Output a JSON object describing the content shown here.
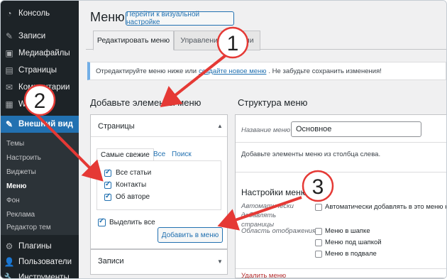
{
  "sidebar": {
    "items": [
      {
        "label": "Консоль",
        "icon": "dashboard-icon",
        "glyph": "◔"
      },
      {
        "label": "Записи",
        "icon": "pin-icon",
        "glyph": "✎"
      },
      {
        "label": "Медиафайлы",
        "icon": "media-icon",
        "glyph": "▣"
      },
      {
        "label": "Страницы",
        "icon": "pages-icon",
        "glyph": "▤"
      },
      {
        "label": "Комментарии",
        "icon": "comments-icon",
        "glyph": "✉"
      },
      {
        "label": "WPForms",
        "icon": "wpforms-icon",
        "glyph": "▦"
      },
      {
        "label": "Внешний вид",
        "icon": "appearance-icon",
        "glyph": "✎"
      }
    ],
    "submenu": [
      "Темы",
      "Настроить",
      "Виджеты",
      "Меню",
      "Фон",
      "Реклама",
      "Редактор тем"
    ],
    "bottom": [
      {
        "label": "Плагины",
        "icon": "plugins-icon",
        "glyph": "⚙"
      },
      {
        "label": "Пользователи",
        "icon": "users-icon",
        "glyph": "👤"
      },
      {
        "label": "Инструменты",
        "icon": "tools-icon",
        "glyph": "🔧"
      }
    ]
  },
  "header": {
    "title": "Меню",
    "customize_button": "Перейти к визуальной настройке"
  },
  "tabs": {
    "edit": "Редактировать меню",
    "manage": "Управление местами"
  },
  "notice": {
    "before": "Отредактируйте меню ниже или",
    "link": "создайте новое меню",
    "after": ". Не забудьте сохранить изменения!"
  },
  "left": {
    "heading": "Добавьте элементы меню",
    "pages_title": "Страницы",
    "tabs": [
      "Самые свежие",
      "Все",
      "Поиск"
    ],
    "items": [
      "Все статьи",
      "Контакты",
      "Об авторе"
    ],
    "select_all": "Выделить все",
    "add_button": "Добавить в меню",
    "posts_title": "Записи"
  },
  "right": {
    "heading": "Структура меню",
    "name_label": "Название меню",
    "name_value": "Основное",
    "hint": "Добавьте элементы меню из столбца слева.",
    "settings_heading": "Настройки меню",
    "auto_label": "Автоматически добавлять страницы",
    "auto_text": "Автоматически добавлять в это меню но",
    "location_label": "Область отображения",
    "locations": [
      "Меню в шапке",
      "Меню под шапкой",
      "Меню в подвале"
    ],
    "cut_label": "Удалить меню"
  },
  "annotations": {
    "numbers": [
      "1",
      "2",
      "3"
    ],
    "color": "#e53935"
  }
}
